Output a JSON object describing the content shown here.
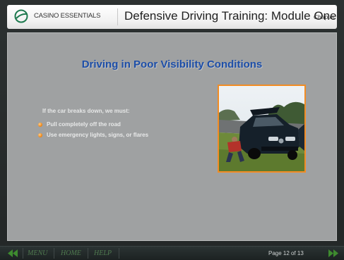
{
  "header": {
    "logo_text": "CASINO ESSENTIALS",
    "course_title": "Defensive Driving Training: Module One",
    "chapter": "Chapter 1"
  },
  "slide": {
    "title": "Driving in Poor Visibility Conditions",
    "intro": "If the car breaks down, we must:",
    "bullets": [
      "Pull completely off the road",
      "Use emergency lights, signs, or flares"
    ],
    "photo_icon": "broken-down-car-photo"
  },
  "footer": {
    "menu": "MENU",
    "home": "HOME",
    "help": "HELP",
    "page": "Page 12 of 13"
  },
  "colors": {
    "accent": "#f28c24",
    "title_blue": "#1d4ea8",
    "slide_bg": "#9fa1a2"
  }
}
